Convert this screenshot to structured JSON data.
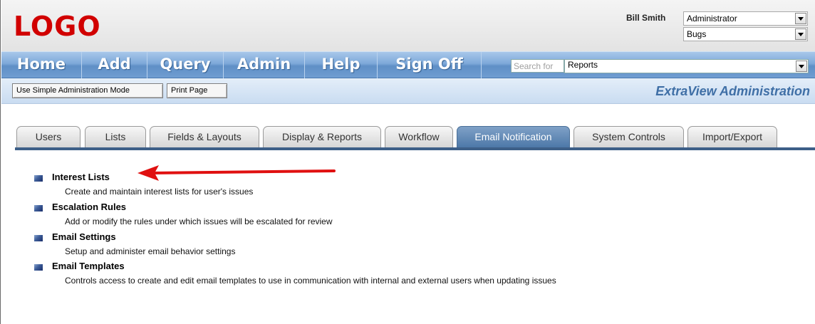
{
  "header": {
    "logo": "LOGO",
    "user_name": "Bill Smith",
    "role_select": "Administrator",
    "area_select": "Bugs"
  },
  "nav": {
    "items": [
      "Home",
      "Add",
      "Query",
      "Admin",
      "Help",
      "Sign Off"
    ],
    "search_placeholder": "Search for",
    "search_scope": "Reports"
  },
  "toolbar": {
    "simple_mode_label": "Use Simple Administration Mode",
    "print_page_label": "Print Page",
    "section_title": "ExtraView Administration"
  },
  "tabs": {
    "items": [
      "Users",
      "Lists",
      "Fields & Layouts",
      "Display & Reports",
      "Workflow",
      "Email Notification",
      "System Controls",
      "Import/Export"
    ],
    "active": "Email Notification"
  },
  "content": {
    "entries": [
      {
        "title": "Interest Lists",
        "description": "Create and maintain interest lists for user's issues"
      },
      {
        "title": "Escalation Rules",
        "description": "Add or modify the rules under which issues will be escalated for review"
      },
      {
        "title": "Email Settings",
        "description": "Setup and administer email behavior settings"
      },
      {
        "title": "Email Templates",
        "description": "Controls access to create and edit email templates to use in communication with internal and external users when updating issues"
      }
    ]
  },
  "colors": {
    "logo": "#d10000",
    "nav_bar": "#6f9dd1",
    "active_tab": "#4d78a8",
    "section_title": "#3f6fa6",
    "arrow": "#e01010"
  }
}
